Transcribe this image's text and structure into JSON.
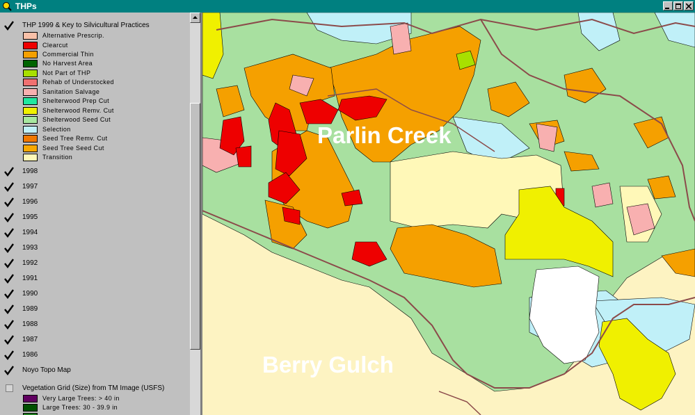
{
  "window": {
    "title": "THPs"
  },
  "toc": {
    "thp_layer": {
      "label": "THP 1999 & Key to Silvicultural Practices",
      "checked": true,
      "legend": [
        {
          "label": "Alternative Prescrip.",
          "color": "#f8c0a8"
        },
        {
          "label": "Clearcut",
          "color": "#ee0000"
        },
        {
          "label": "Commercial Thin",
          "color": "#f5a000"
        },
        {
          "label": "No Harvest Area",
          "color": "#006400"
        },
        {
          "label": "Not Part of THP",
          "color": "#a8e000"
        },
        {
          "label": "Rehab of Understocked",
          "color": "#f07070"
        },
        {
          "label": "Sanitation Salvage",
          "color": "#f8b0b0"
        },
        {
          "label": "Shelterwood Prep Cut",
          "color": "#20e8a0"
        },
        {
          "label": "Shelterwood Remv. Cut",
          "color": "#f0f000"
        },
        {
          "label": "Shelterwood Seed Cut",
          "color": "#a8e8a0"
        },
        {
          "label": "Selection",
          "color": "#c0f0f8"
        },
        {
          "label": "Seed Tree Remv. Cut",
          "color": "#f07800"
        },
        {
          "label": "Seed Tree Seed Cut",
          "color": "#f8a800"
        },
        {
          "label": "Transition",
          "color": "#fff8b8"
        }
      ]
    },
    "year_layers": [
      {
        "label": "1998",
        "checked": true
      },
      {
        "label": "1997",
        "checked": true
      },
      {
        "label": "1996",
        "checked": true
      },
      {
        "label": "1995",
        "checked": true
      },
      {
        "label": "1994",
        "checked": true
      },
      {
        "label": "1993",
        "checked": true
      },
      {
        "label": "1992",
        "checked": true
      },
      {
        "label": "1991",
        "checked": true
      },
      {
        "label": "1990",
        "checked": true
      },
      {
        "label": "1989",
        "checked": true
      },
      {
        "label": "1988",
        "checked": true
      },
      {
        "label": "1987",
        "checked": true
      },
      {
        "label": "1986",
        "checked": true
      }
    ],
    "topo_layer": {
      "label": "Noyo Topo Map",
      "checked": true
    },
    "veg_layer": {
      "label": "Vegetation Grid (Size) from TM Image (USFS)",
      "checked": false,
      "legend": [
        {
          "label": "Very Large Trees: > 40  in",
          "color": "#600060"
        },
        {
          "label": "Large Trees: 30 - 39.9 in",
          "color": "#005000"
        }
      ]
    }
  },
  "map": {
    "labels": [
      "Parlin Creek",
      "Berry Gulch"
    ],
    "colors": {
      "background": "#fdf3c2",
      "forest": "#a8e0a0",
      "road": "#8b4a4a",
      "boundary": "#000000",
      "selection": "#c0f0f8",
      "transition": "#fff8b8"
    }
  }
}
